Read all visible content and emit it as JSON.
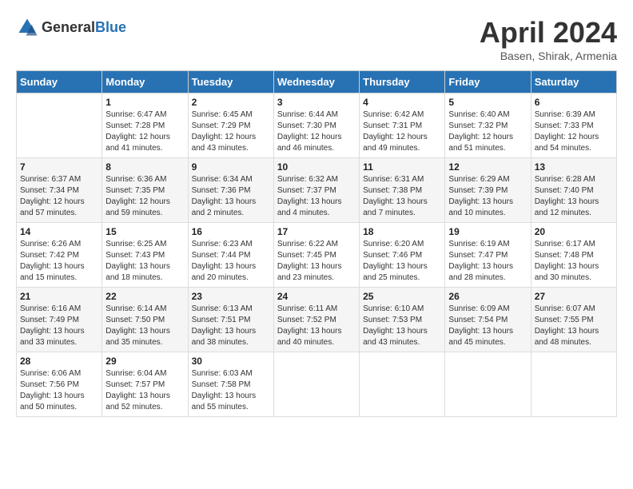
{
  "header": {
    "logo_general": "General",
    "logo_blue": "Blue",
    "month_title": "April 2024",
    "location": "Basen, Shirak, Armenia"
  },
  "days_of_week": [
    "Sunday",
    "Monday",
    "Tuesday",
    "Wednesday",
    "Thursday",
    "Friday",
    "Saturday"
  ],
  "weeks": [
    [
      {
        "day": "",
        "info": ""
      },
      {
        "day": "1",
        "info": "Sunrise: 6:47 AM\nSunset: 7:28 PM\nDaylight: 12 hours\nand 41 minutes."
      },
      {
        "day": "2",
        "info": "Sunrise: 6:45 AM\nSunset: 7:29 PM\nDaylight: 12 hours\nand 43 minutes."
      },
      {
        "day": "3",
        "info": "Sunrise: 6:44 AM\nSunset: 7:30 PM\nDaylight: 12 hours\nand 46 minutes."
      },
      {
        "day": "4",
        "info": "Sunrise: 6:42 AM\nSunset: 7:31 PM\nDaylight: 12 hours\nand 49 minutes."
      },
      {
        "day": "5",
        "info": "Sunrise: 6:40 AM\nSunset: 7:32 PM\nDaylight: 12 hours\nand 51 minutes."
      },
      {
        "day": "6",
        "info": "Sunrise: 6:39 AM\nSunset: 7:33 PM\nDaylight: 12 hours\nand 54 minutes."
      }
    ],
    [
      {
        "day": "7",
        "info": "Sunrise: 6:37 AM\nSunset: 7:34 PM\nDaylight: 12 hours\nand 57 minutes."
      },
      {
        "day": "8",
        "info": "Sunrise: 6:36 AM\nSunset: 7:35 PM\nDaylight: 12 hours\nand 59 minutes."
      },
      {
        "day": "9",
        "info": "Sunrise: 6:34 AM\nSunset: 7:36 PM\nDaylight: 13 hours\nand 2 minutes."
      },
      {
        "day": "10",
        "info": "Sunrise: 6:32 AM\nSunset: 7:37 PM\nDaylight: 13 hours\nand 4 minutes."
      },
      {
        "day": "11",
        "info": "Sunrise: 6:31 AM\nSunset: 7:38 PM\nDaylight: 13 hours\nand 7 minutes."
      },
      {
        "day": "12",
        "info": "Sunrise: 6:29 AM\nSunset: 7:39 PM\nDaylight: 13 hours\nand 10 minutes."
      },
      {
        "day": "13",
        "info": "Sunrise: 6:28 AM\nSunset: 7:40 PM\nDaylight: 13 hours\nand 12 minutes."
      }
    ],
    [
      {
        "day": "14",
        "info": "Sunrise: 6:26 AM\nSunset: 7:42 PM\nDaylight: 13 hours\nand 15 minutes."
      },
      {
        "day": "15",
        "info": "Sunrise: 6:25 AM\nSunset: 7:43 PM\nDaylight: 13 hours\nand 18 minutes."
      },
      {
        "day": "16",
        "info": "Sunrise: 6:23 AM\nSunset: 7:44 PM\nDaylight: 13 hours\nand 20 minutes."
      },
      {
        "day": "17",
        "info": "Sunrise: 6:22 AM\nSunset: 7:45 PM\nDaylight: 13 hours\nand 23 minutes."
      },
      {
        "day": "18",
        "info": "Sunrise: 6:20 AM\nSunset: 7:46 PM\nDaylight: 13 hours\nand 25 minutes."
      },
      {
        "day": "19",
        "info": "Sunrise: 6:19 AM\nSunset: 7:47 PM\nDaylight: 13 hours\nand 28 minutes."
      },
      {
        "day": "20",
        "info": "Sunrise: 6:17 AM\nSunset: 7:48 PM\nDaylight: 13 hours\nand 30 minutes."
      }
    ],
    [
      {
        "day": "21",
        "info": "Sunrise: 6:16 AM\nSunset: 7:49 PM\nDaylight: 13 hours\nand 33 minutes."
      },
      {
        "day": "22",
        "info": "Sunrise: 6:14 AM\nSunset: 7:50 PM\nDaylight: 13 hours\nand 35 minutes."
      },
      {
        "day": "23",
        "info": "Sunrise: 6:13 AM\nSunset: 7:51 PM\nDaylight: 13 hours\nand 38 minutes."
      },
      {
        "day": "24",
        "info": "Sunrise: 6:11 AM\nSunset: 7:52 PM\nDaylight: 13 hours\nand 40 minutes."
      },
      {
        "day": "25",
        "info": "Sunrise: 6:10 AM\nSunset: 7:53 PM\nDaylight: 13 hours\nand 43 minutes."
      },
      {
        "day": "26",
        "info": "Sunrise: 6:09 AM\nSunset: 7:54 PM\nDaylight: 13 hours\nand 45 minutes."
      },
      {
        "day": "27",
        "info": "Sunrise: 6:07 AM\nSunset: 7:55 PM\nDaylight: 13 hours\nand 48 minutes."
      }
    ],
    [
      {
        "day": "28",
        "info": "Sunrise: 6:06 AM\nSunset: 7:56 PM\nDaylight: 13 hours\nand 50 minutes."
      },
      {
        "day": "29",
        "info": "Sunrise: 6:04 AM\nSunset: 7:57 PM\nDaylight: 13 hours\nand 52 minutes."
      },
      {
        "day": "30",
        "info": "Sunrise: 6:03 AM\nSunset: 7:58 PM\nDaylight: 13 hours\nand 55 minutes."
      },
      {
        "day": "",
        "info": ""
      },
      {
        "day": "",
        "info": ""
      },
      {
        "day": "",
        "info": ""
      },
      {
        "day": "",
        "info": ""
      }
    ]
  ]
}
